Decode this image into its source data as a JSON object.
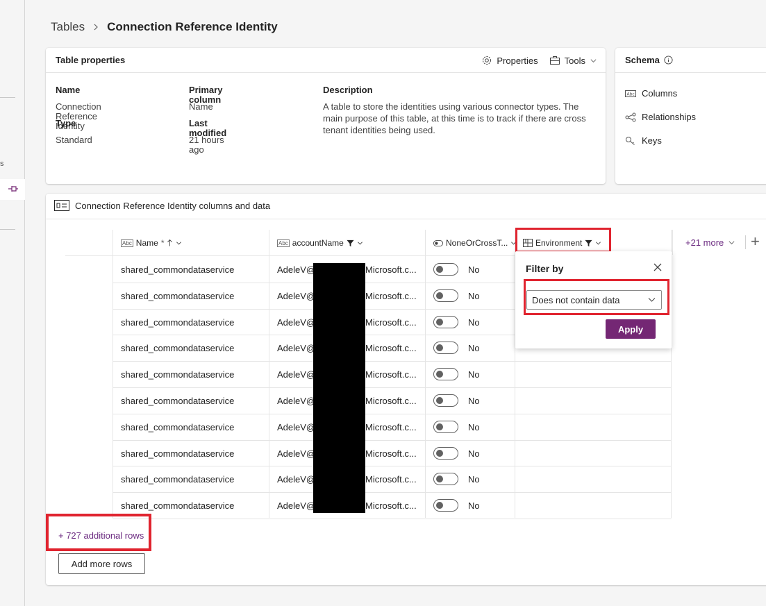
{
  "leftnav": {
    "fragment": "s"
  },
  "breadcrumb": {
    "parent": "Tables",
    "current": "Connection Reference Identity"
  },
  "table_properties": {
    "title": "Table properties",
    "properties_button": "Properties",
    "tools_button": "Tools",
    "fields": {
      "name_label": "Name",
      "name_value": "Connection Reference Identity",
      "type_label": "Type",
      "type_value": "Standard",
      "primary_label": "Primary column",
      "primary_value": "Name",
      "modified_label": "Last modified",
      "modified_value": "21 hours ago",
      "description_label": "Description",
      "description_value": "A table to store the identities using various connector types. The main purpose of this table, at this time is to track if there are cross tenant identities being used."
    }
  },
  "schema": {
    "title": "Schema",
    "items": [
      "Columns",
      "Relationships",
      "Keys"
    ]
  },
  "data_section": {
    "title": "Connection Reference Identity columns and data",
    "columns": {
      "name": "Name",
      "name_required": "*",
      "account": "accountName",
      "none_or_cross": "NoneOrCrossT...",
      "environment": "Environment"
    },
    "more_columns": "+21 more",
    "rows": [
      {
        "name": "shared_commondataservice",
        "account_start": "AdeleV@",
        "account_end": "Microsoft.c...",
        "toggle": "No"
      },
      {
        "name": "shared_commondataservice",
        "account_start": "AdeleV@",
        "account_end": "Microsoft.c...",
        "toggle": "No"
      },
      {
        "name": "shared_commondataservice",
        "account_start": "AdeleV@",
        "account_end": "Microsoft.c...",
        "toggle": "No"
      },
      {
        "name": "shared_commondataservice",
        "account_start": "AdeleV@",
        "account_end": "Microsoft.c...",
        "toggle": "No"
      },
      {
        "name": "shared_commondataservice",
        "account_start": "AdeleV@",
        "account_end": "Microsoft.c...",
        "toggle": "No"
      },
      {
        "name": "shared_commondataservice",
        "account_start": "AdeleV@",
        "account_end": "Microsoft.c...",
        "toggle": "No"
      },
      {
        "name": "shared_commondataservice",
        "account_start": "AdeleV@",
        "account_end": "Microsoft.c...",
        "toggle": "No"
      },
      {
        "name": "shared_commondataservice",
        "account_start": "AdeleV@",
        "account_end": "Microsoft.c...",
        "toggle": "No"
      },
      {
        "name": "shared_commondataservice",
        "account_start": "AdeleV@",
        "account_end": "Microsoft.c...",
        "toggle": "No"
      },
      {
        "name": "shared_commondataservice",
        "account_start": "AdeleV@",
        "account_end": "Microsoft.c...",
        "toggle": "No"
      }
    ],
    "additional_rows": "+ 727 additional rows",
    "add_more_rows": "Add more rows"
  },
  "filter_popup": {
    "title": "Filter by",
    "selected": "Does not contain data",
    "apply": "Apply"
  },
  "colors": {
    "accent": "#742774",
    "highlight": "#e0242f"
  }
}
